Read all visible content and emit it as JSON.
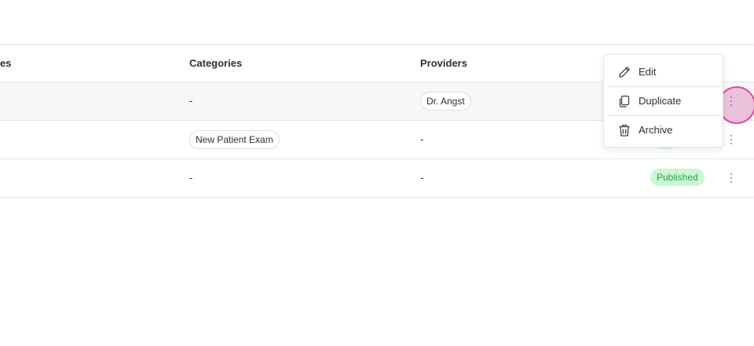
{
  "table": {
    "headers": {
      "col1_partial": "es",
      "categories": "Categories",
      "providers": "Providers"
    },
    "rows": [
      {
        "categories": "-",
        "providers": "Dr. Angst",
        "status": ""
      },
      {
        "categories": "New Patient Exam",
        "providers": "-",
        "status": ""
      },
      {
        "categories": "-",
        "providers": "-",
        "status": "Published"
      }
    ]
  },
  "menu": {
    "edit": "Edit",
    "duplicate": "Duplicate",
    "archive": "Archive"
  },
  "colors": {
    "published_bg": "#c9f6d3",
    "published_text": "#2f9e54",
    "click_highlight": "#d64ea1"
  }
}
